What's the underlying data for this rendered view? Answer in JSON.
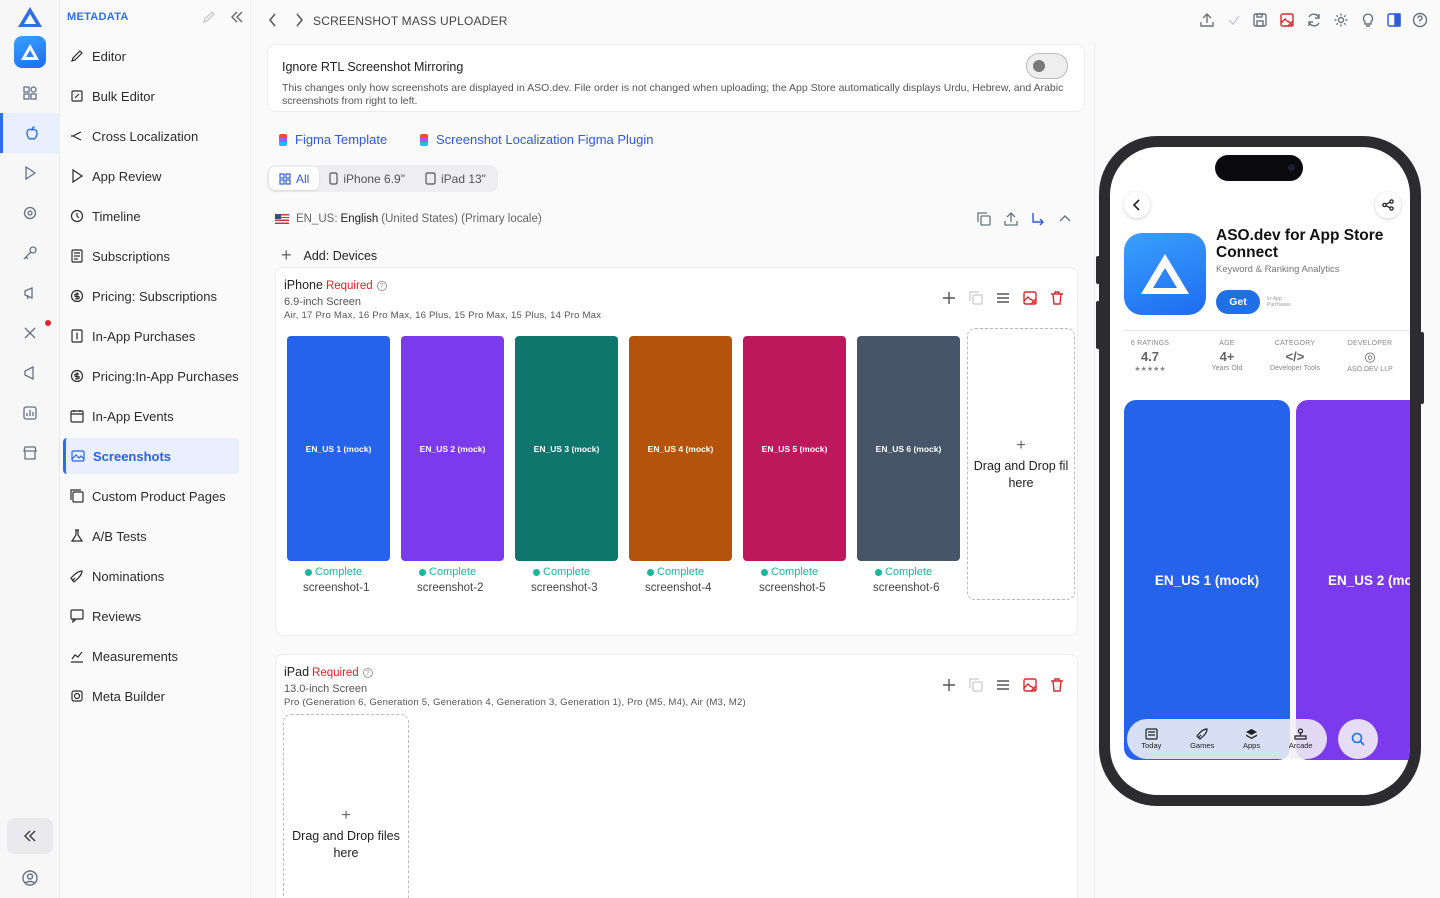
{
  "sidebar": {
    "title": "METADATA",
    "items": [
      {
        "label": "Editor"
      },
      {
        "label": "Bulk Editor"
      },
      {
        "label": "Cross Localization"
      },
      {
        "label": "App Review"
      },
      {
        "label": "Timeline"
      },
      {
        "label": "Subscriptions"
      },
      {
        "label": "Pricing: Subscriptions"
      },
      {
        "label": "In-App Purchases"
      },
      {
        "label": "Pricing:In-App Purchases"
      },
      {
        "label": "In-App Events"
      },
      {
        "label": "Screenshots",
        "active": true
      },
      {
        "label": "Custom Product Pages"
      },
      {
        "label": "A/B Tests"
      },
      {
        "label": "Nominations"
      },
      {
        "label": "Reviews"
      },
      {
        "label": "Measurements"
      },
      {
        "label": "Meta Builder"
      }
    ]
  },
  "header": {
    "breadcrumb": "SCREENSHOT MASS UPLOADER"
  },
  "rtl": {
    "title": "Ignore RTL Screenshot Mirroring",
    "description": "This changes only how screenshots are displayed in ASO.dev. File order is not changed when uploading; the App Store automatically displays Urdu, Hebrew, and Arabic screenshots from right to left.",
    "enabled": false
  },
  "links": {
    "figma_template": "Figma Template",
    "figma_plugin": "Screenshot Localization Figma Plugin"
  },
  "filter": {
    "all": "All",
    "iphone": "iPhone 6.9\"",
    "ipad": "iPad 13\"",
    "selected": "All"
  },
  "locale": {
    "code": "EN_US:",
    "name": "English",
    "detail": "(United States) (Primary locale)"
  },
  "add_devices": "Add: Devices",
  "iphone": {
    "name": "iPhone",
    "required": "Required",
    "screen": "6.9-inch Screen",
    "models": "Air, 17 Pro Max, 16 Pro Max, 16 Plus, 15 Pro Max, 15 Plus, 14 Pro Max",
    "drop": "Drag and Drop fil here",
    "screenshots": [
      {
        "label": "EN_US 1 (mock)",
        "status": "Complete",
        "file": "screenshot-1",
        "color": "#2563eb"
      },
      {
        "label": "EN_US 2 (mock)",
        "status": "Complete",
        "file": "screenshot-2",
        "color": "#7c3aed"
      },
      {
        "label": "EN_US 3 (mock)",
        "status": "Complete",
        "file": "screenshot-3",
        "color": "#0f766e"
      },
      {
        "label": "EN_US 4 (mock)",
        "status": "Complete",
        "file": "screenshot-4",
        "color": "#b45309"
      },
      {
        "label": "EN_US 5 (mock)",
        "status": "Complete",
        "file": "screenshot-5",
        "color": "#be185d"
      },
      {
        "label": "EN_US 6 (mock)",
        "status": "Complete",
        "file": "screenshot-6",
        "color": "#475569"
      }
    ]
  },
  "ipad": {
    "name": "iPad",
    "required": "Required",
    "screen": "13.0-inch Screen",
    "models": "Pro (Generation 6, Generation 5, Generation 4, Generation 3, Generation 1), Pro (M5, M4), Air (M3, M2)",
    "drop": "Drag and Drop files here"
  },
  "preview": {
    "app_name": "ASO.dev for App Store Connect",
    "subtitle": "Keyword & Ranking Analytics",
    "get": "Get",
    "iap": "In-App Purchases",
    "stats": [
      {
        "key": "6 RATINGS",
        "value": "4.7",
        "sub": "★★★★★"
      },
      {
        "key": "AGE",
        "value": "4+",
        "sub": "Years Old"
      },
      {
        "key": "CATEGORY",
        "value": "</>",
        "sub": "Developer Tools"
      },
      {
        "key": "DEVELOPER",
        "value": "◎",
        "sub": "ASO.DEV LLP"
      }
    ],
    "shots": [
      "EN_US 1 (mock)",
      "EN_US 2 (mock)"
    ],
    "tabs": [
      "Today",
      "Games",
      "Apps",
      "Arcade"
    ]
  },
  "colors": {
    "accent": "#2f6fe4",
    "complete": "#14b89a",
    "danger": "#d22d2d"
  }
}
